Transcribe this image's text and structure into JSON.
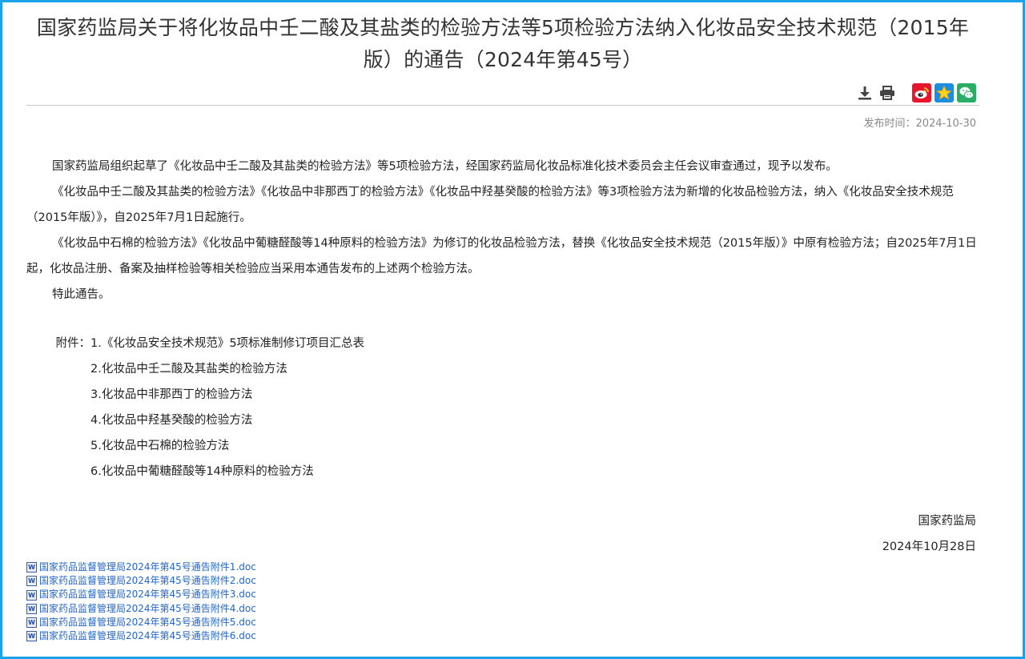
{
  "title": "国家药监局关于将化妆品中壬二酸及其盐类的检验方法等5项检验方法纳入化妆品安全技术规范（2015年版）的通告（2024年第45号）",
  "toolbar": {
    "download_icon": "download-icon",
    "print_icon": "print-icon",
    "weibo_icon": "weibo-icon",
    "favorite_icon": "star-icon",
    "wechat_icon": "wechat-icon"
  },
  "colors": {
    "frame": "#1aa3e8",
    "link": "#2466c7",
    "weibo": "#e6162d",
    "favorite": "#1a8fe0",
    "wechat": "#2aae67"
  },
  "publish_time": "发布时间：2024-10-30",
  "paragraphs": [
    "国家药监局组织起草了《化妆品中壬二酸及其盐类的检验方法》等5项检验方法，经国家药监局化妆品标准化技术委员会主任会议审查通过，现予以发布。",
    "《化妆品中壬二酸及其盐类的检验方法》《化妆品中非那西丁的检验方法》《化妆品中羟基癸酸的检验方法》等3项检验方法为新增的化妆品检验方法，纳入《化妆品安全技术规范（2015年版）》，自2025年7月1日起施行。",
    "《化妆品中石棉的检验方法》《化妆品中葡糖醛酸等14种原料的检验方法》为修订的化妆品检验方法，替换《化妆品安全技术规范（2015年版）》中原有检验方法；自2025年7月1日起，化妆品注册、备案及抽样检验等相关检验应当采用本通告发布的上述两个检验方法。",
    "特此通告。"
  ],
  "attachments_label": "附件：",
  "attachments": [
    "1.《化妆品安全技术规范》5项标准制修订项目汇总表",
    "2.化妆品中壬二酸及其盐类的检验方法",
    "3.化妆品中非那西丁的检验方法",
    "4.化妆品中羟基癸酸的检验方法",
    "5.化妆品中石棉的检验方法",
    "6.化妆品中葡糖醛酸等14种原料的检验方法"
  ],
  "signature": {
    "org": "国家药监局",
    "date": "2024年10月28日"
  },
  "files": [
    "国家药品监督管理局2024年第45号通告附件1.doc",
    "国家药品监督管理局2024年第45号通告附件2.doc",
    "国家药品监督管理局2024年第45号通告附件3.doc",
    "国家药品监督管理局2024年第45号通告附件4.doc",
    "国家药品监督管理局2024年第45号通告附件5.doc",
    "国家药品监督管理局2024年第45号通告附件6.doc"
  ]
}
